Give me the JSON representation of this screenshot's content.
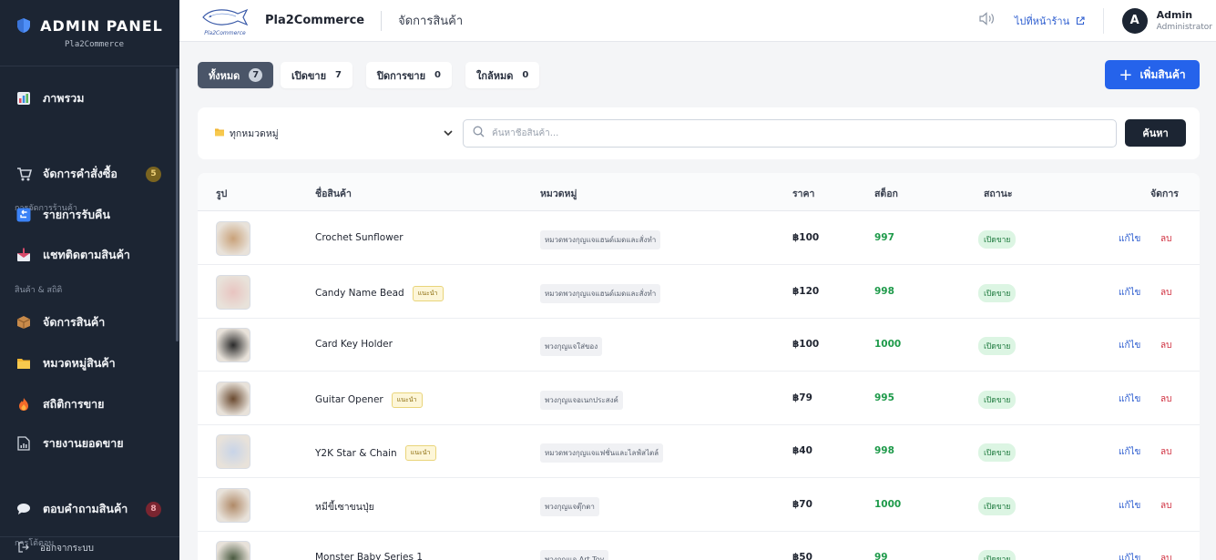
{
  "sidebar": {
    "title": "ADMIN PANEL",
    "subtitle": "Pla2Commerce",
    "items": [
      {
        "label": "ภาพรวม",
        "icon": "chart-icon"
      },
      {
        "section": "การจัดการร้านค้า"
      },
      {
        "label": "จัดการคำสั่งซื้อ",
        "icon": "cart-icon",
        "badge": "5"
      },
      {
        "label": "รายการรับคืน",
        "icon": "return-icon"
      },
      {
        "label": "แชทติดตามสินค้า",
        "icon": "inbox-icon"
      },
      {
        "section": "สินค้า & สถิติ"
      },
      {
        "label": "จัดการสินค้า",
        "icon": "box-icon"
      },
      {
        "label": "หมวดหมู่สินค้า",
        "icon": "folder-icon"
      },
      {
        "label": "สถิติการขาย",
        "icon": "fire-icon"
      },
      {
        "label": "รายงานยอดขาย",
        "icon": "report-icon"
      },
      {
        "section": "การโต้ตอบ"
      },
      {
        "label": "ตอบคำถามสินค้า",
        "icon": "chat-bubble-icon",
        "badge": "8"
      }
    ],
    "logout": "ออกจากระบบ"
  },
  "header": {
    "logo_text": "Pla2Commerce",
    "store_name": "Pla2Commerce",
    "page_title": "จัดการสินค้า",
    "store_link": "ไปที่หน้าร้าน",
    "user_initial": "A",
    "user_name": "Admin",
    "user_role": "Administrator"
  },
  "tabs": [
    {
      "label": "ทั้งหมด",
      "count": "7",
      "active": true
    },
    {
      "label": "เปิดขาย",
      "count": "7",
      "active": false
    },
    {
      "label": "ปิดการขาย",
      "count": "0",
      "active": false
    },
    {
      "label": "ใกล้หมด",
      "count": "0",
      "active": false
    }
  ],
  "add_button": "เพิ่มสินค้า",
  "filter": {
    "category_selected": "ทุกหมวดหมู่",
    "search_placeholder": "ค้นหาชื่อสินค้า...",
    "search_button": "ค้นหา"
  },
  "table": {
    "headers": [
      "รูป",
      "ชื่อสินค้า",
      "หมวดหมู่",
      "ราคา",
      "สต็อก",
      "สถานะ",
      "จัดการ"
    ],
    "edit_label": "แก้ไข",
    "delete_label": "ลบ",
    "recommended_label": "แนะนำ",
    "rows": [
      {
        "name": "Crochet Sunflower",
        "recommended": false,
        "category": "หมวดพวงกุญแจแฮนด์เมดและสั่งทำ",
        "price": "฿100",
        "stock": "997",
        "status": "เปิดขาย",
        "thumb_color": "#c9a27a"
      },
      {
        "name": "Candy Name Bead",
        "recommended": true,
        "category": "หมวดพวงกุญแจแฮนด์เมดและสั่งทำ",
        "price": "฿120",
        "stock": "998",
        "status": "เปิดขาย",
        "thumb_color": "#e8c4c0"
      },
      {
        "name": "Card Key Holder",
        "recommended": false,
        "category": "พวงกุญแจใส่ของ",
        "price": "฿100",
        "stock": "1000",
        "status": "เปิดขาย",
        "thumb_color": "#2a2a2a"
      },
      {
        "name": "Guitar Opener",
        "recommended": true,
        "category": "พวงกุญแจอเนกประสงค์",
        "price": "฿79",
        "stock": "995",
        "status": "เปิดขาย",
        "thumb_color": "#6a4a30"
      },
      {
        "name": "Y2K Star & Chain",
        "recommended": true,
        "category": "หมวดพวงกุญแจแฟชั่นและไลฟ์สไตล์",
        "price": "฿40",
        "stock": "998",
        "status": "เปิดขาย",
        "thumb_color": "#c8d4e8"
      },
      {
        "name": "หมีขี้เซาขนปุ่ย",
        "recommended": false,
        "category": "พวงกุญแจตุ๊กตา",
        "price": "฿70",
        "stock": "1000",
        "status": "เปิดขาย",
        "thumb_color": "#b08a68"
      },
      {
        "name": "Monster Baby Series 1",
        "recommended": false,
        "category": "พวงกุญแจ Art Toy",
        "price": "฿50",
        "stock": "99",
        "status": "เปิดขาย",
        "thumb_color": "#4a5a40"
      }
    ]
  }
}
